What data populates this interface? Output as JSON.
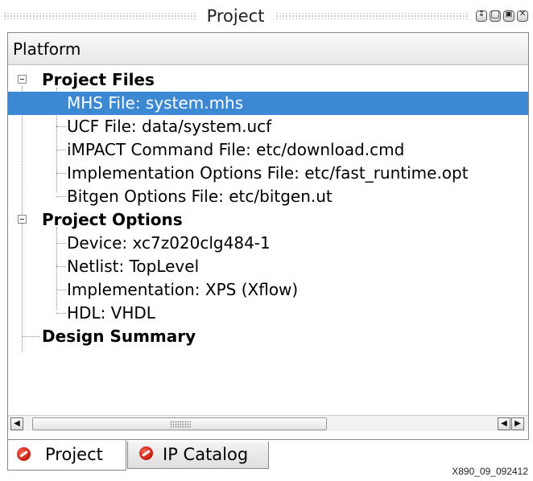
{
  "window": {
    "title": "Project",
    "buttons": [
      "restore-icon",
      "maximize-icon",
      "float-icon",
      "close-icon"
    ]
  },
  "tree": {
    "column_header": "Platform",
    "groups": [
      {
        "label": "Project Files",
        "expanded": true,
        "children": [
          {
            "label": "MHS File: system.mhs",
            "selected": true
          },
          {
            "label": "UCF File: data/system.ucf"
          },
          {
            "label": "iMPACT Command File: etc/download.cmd"
          },
          {
            "label": "Implementation Options File: etc/fast_runtime.opt"
          },
          {
            "label": "Bitgen Options File: etc/bitgen.ut"
          }
        ]
      },
      {
        "label": "Project Options",
        "expanded": true,
        "children": [
          {
            "label": "Device: xc7z020clg484-1"
          },
          {
            "label": "Netlist: TopLevel"
          },
          {
            "label": "Implementation: XPS (Xflow)"
          },
          {
            "label": "HDL: VHDL"
          }
        ]
      },
      {
        "label": "Design Summary"
      }
    ]
  },
  "scrollbar": {
    "left_arrow": "◀",
    "right_arrow": "▶"
  },
  "tabs": [
    {
      "label": "Project",
      "active": true
    },
    {
      "label": "IP Catalog",
      "active": false
    }
  ],
  "colors": {
    "selection": "#3d88d3",
    "tab_icon": "#d42a1a"
  },
  "figure_id": "X890_09_092412"
}
